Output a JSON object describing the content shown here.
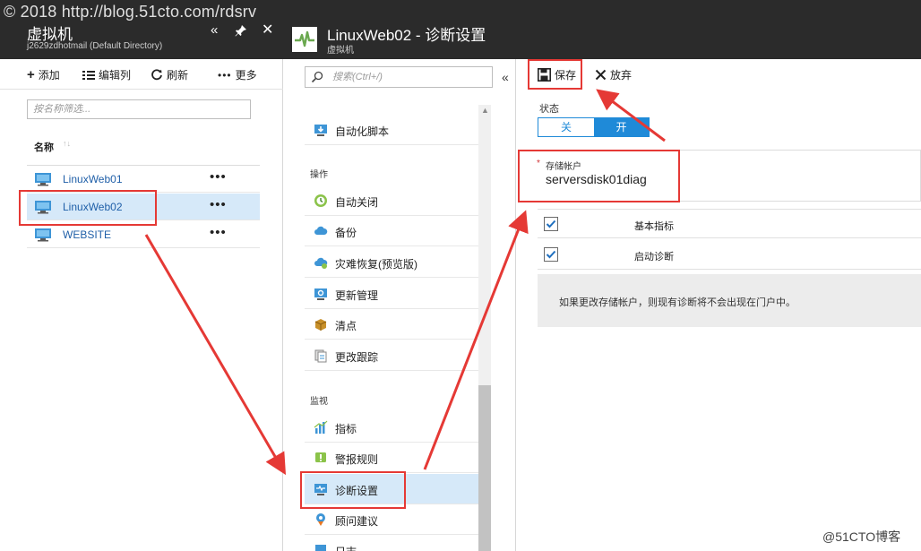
{
  "watermark": {
    "top": "© 2018 http://blog.51cto.com/rdsrv",
    "bottom": "@51CTO博客"
  },
  "left_blade": {
    "title": "虚拟机",
    "subtitle": "j2629zdhotmail (Default Directory)",
    "controls": {
      "collapse": "«",
      "close": "✕"
    },
    "toolbar": {
      "add": "添加",
      "edit_columns": "编辑列",
      "refresh": "刷新",
      "more": "更多"
    },
    "filter_placeholder": "按名称筛选...",
    "column_name": "名称",
    "sort_glyph": "↑↓",
    "row_more": "•••",
    "vms": [
      {
        "name": "LinuxWeb01"
      },
      {
        "name": "LinuxWeb02"
      },
      {
        "name": "WEBSITE"
      }
    ]
  },
  "mid_blade": {
    "title": "LinuxWeb02 - 诊断设置",
    "subtitle": "虚拟机",
    "search_placeholder": "搜索(Ctrl+/)",
    "collapse": "«",
    "items": {
      "autoscript": "自动化脚本",
      "section_ops": "操作",
      "autoshutdown": "自动关闭",
      "backup": "备份",
      "dr": "灾难恢复(预览版)",
      "update": "更新管理",
      "inventory": "清点",
      "changetrack": "更改跟踪",
      "section_monitor": "监视",
      "metrics": "指标",
      "alerts": "警报规则",
      "diag": "诊断设置",
      "advisor": "顾问建议",
      "next": "日志"
    }
  },
  "right_blade": {
    "save": "保存",
    "discard": "放弃",
    "status_label": "状态",
    "toggle_off": "关",
    "toggle_on": "开",
    "storage_required": "*",
    "storage_label": "存储帐户",
    "storage_value": "serversdisk01diag",
    "check_basic": "基本指标",
    "check_boot": "启动诊断",
    "info": "如果更改存储帐户，则现有诊断将不会出现在门户中。"
  },
  "colors": {
    "accent": "#1f8ad8",
    "header_bg": "#2b2b2b",
    "selected_bg": "#d6e9f9",
    "annotation_red": "#e53935",
    "link": "#1f5fa8"
  }
}
